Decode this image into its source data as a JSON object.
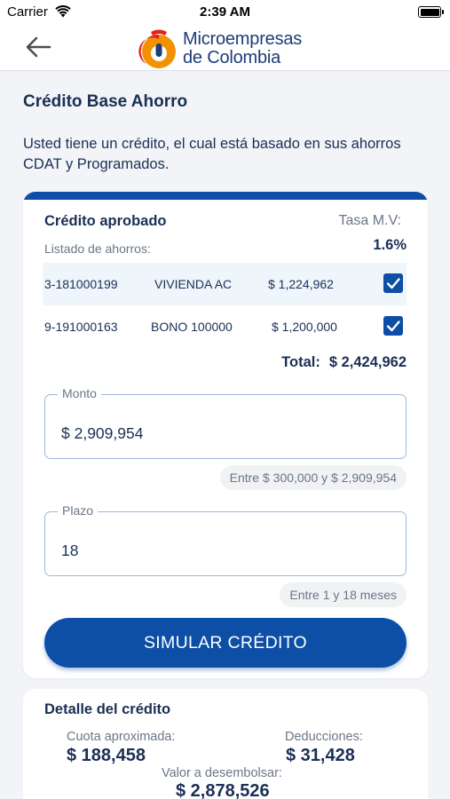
{
  "status_bar": {
    "carrier": "Carrier",
    "time": "2:39 AM"
  },
  "header": {
    "logo_line1": "Microempresas",
    "logo_line2": "de Colombia",
    "back_icon": "arrow-left-icon"
  },
  "page": {
    "title": "Crédito Base Ahorro",
    "description": "Usted tiene un crédito, el cual está basado en sus ahorros CDAT y Programados."
  },
  "credit_card": {
    "title": "Crédito aprobado",
    "rate_label": "Tasa M.V:",
    "rate_value": "1.6%",
    "savings_label": "Listado de ahorros:",
    "savings": [
      {
        "account": "3-181000199",
        "type": "VIVIENDA AC",
        "amount": "$ 1,224,962",
        "checked": true
      },
      {
        "account": "9-191000163",
        "type": "BONO 100000",
        "amount": "$ 1,200,000",
        "checked": true
      }
    ],
    "total_label": "Total:",
    "total_value": "$ 2,424,962",
    "amount_field": {
      "label": "Monto",
      "value": "$ 2,909,954",
      "hint": "Entre $ 300,000 y $ 2,909,954"
    },
    "term_field": {
      "label": "Plazo",
      "value": "18",
      "hint": "Entre 1 y 18 meses"
    },
    "simulate_button": "SIMULAR CRÉDITO"
  },
  "detail": {
    "title": "Detalle del crédito",
    "installment_label": "Cuota aproximada:",
    "installment_value": "$ 188,458",
    "deductions_label": "Deducciones:",
    "deductions_value": "$ 31,428",
    "disbursement_label": "Valor a desembolsar:",
    "disbursement_value": "$ 2,878,526"
  },
  "colors": {
    "primary": "#0d4ea6",
    "text": "#1b2f55",
    "muted": "#6b7688",
    "background": "#f2f4f7",
    "logo_red": "#e2231a",
    "logo_orange": "#f39200"
  }
}
